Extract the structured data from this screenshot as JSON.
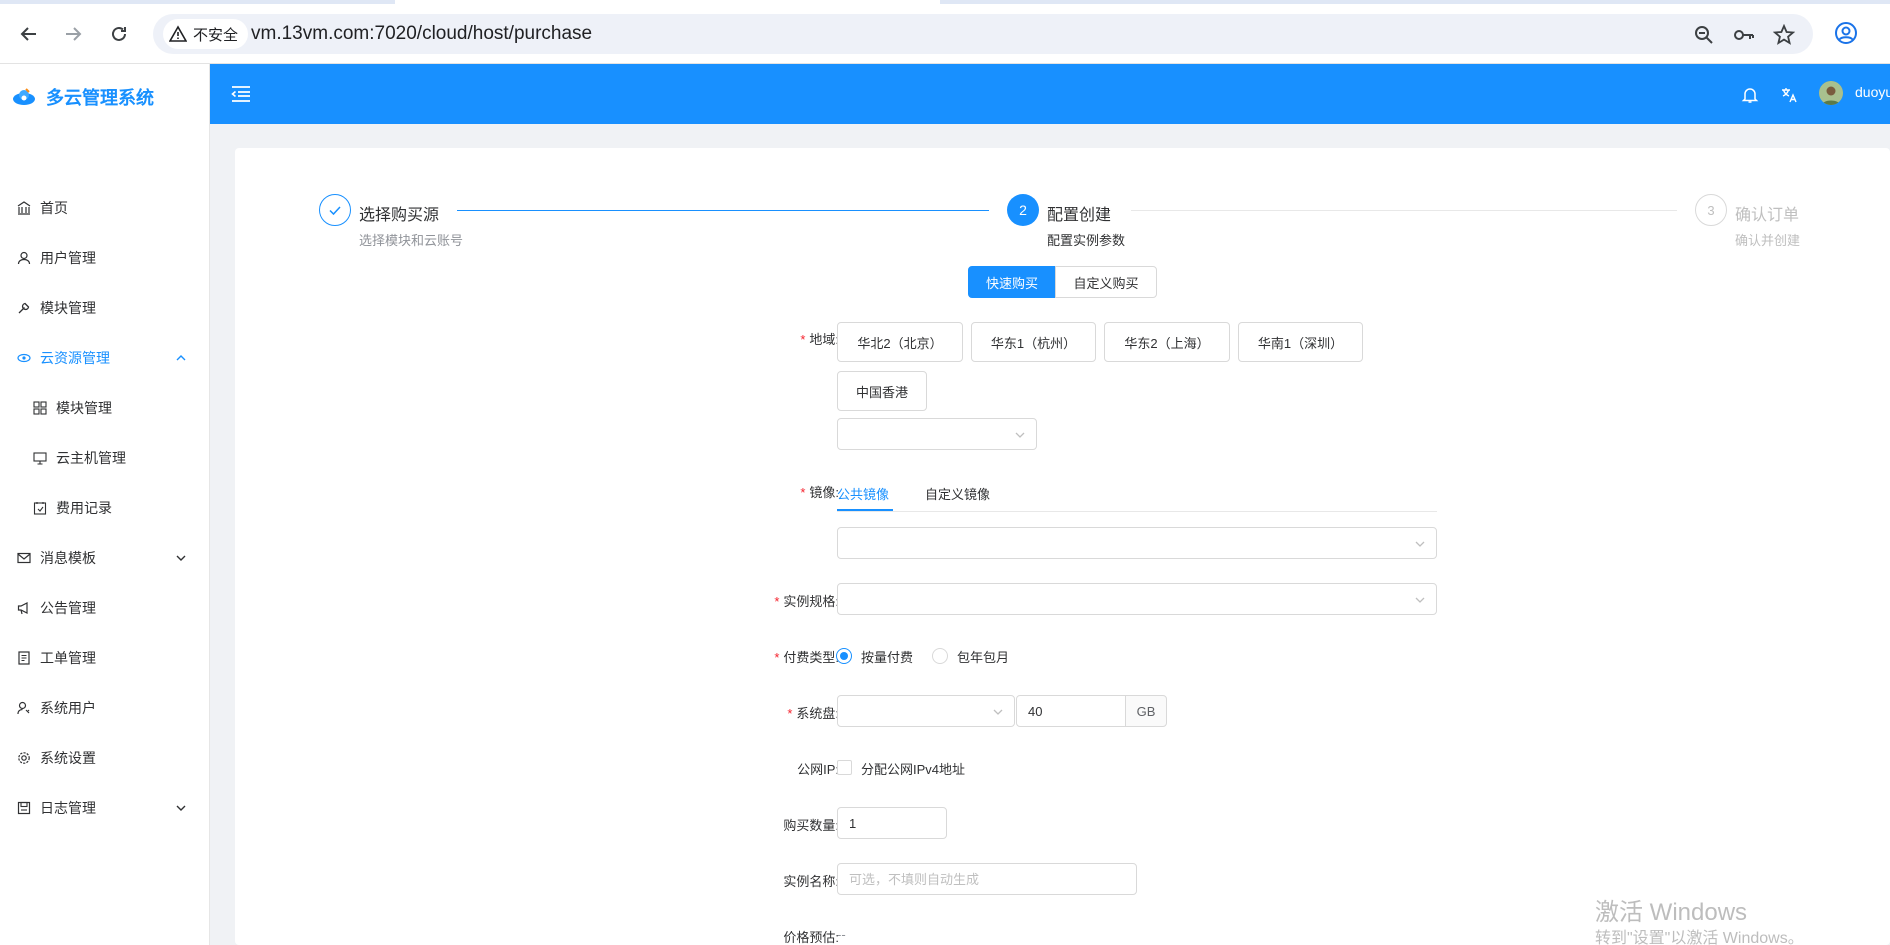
{
  "browser": {
    "insecure_label": "不安全",
    "url": "vm.13vm.com:7020/cloud/host/purchase"
  },
  "app": {
    "name": "多云管理系统",
    "user": "duoyu"
  },
  "sidebar": {
    "items": [
      {
        "label": "首页"
      },
      {
        "label": "用户管理"
      },
      {
        "label": "模块管理"
      },
      {
        "label": "云资源管理"
      },
      {
        "label": "模块管理"
      },
      {
        "label": "云主机管理"
      },
      {
        "label": "费用记录"
      },
      {
        "label": "消息模板"
      },
      {
        "label": "公告管理"
      },
      {
        "label": "工单管理"
      },
      {
        "label": "系统用户"
      },
      {
        "label": "系统设置"
      },
      {
        "label": "日志管理"
      }
    ]
  },
  "steps": [
    {
      "title": "选择购买源",
      "desc": "选择模块和云账号",
      "status": "done"
    },
    {
      "number": "2",
      "title": "配置创建",
      "desc": "配置实例参数",
      "status": "active"
    },
    {
      "number": "3",
      "title": "确认订单",
      "desc": "确认并创建",
      "status": "wait"
    }
  ],
  "mode": {
    "quick": "快速购买",
    "custom": "自定义购买"
  },
  "form": {
    "region": {
      "label": "地域:",
      "options": [
        "华北2（北京）",
        "华东1（杭州）",
        "华东2（上海）",
        "华南1（深圳）",
        "中国香港"
      ]
    },
    "image": {
      "label": "镜像:",
      "tabs": [
        "公共镜像",
        "自定义镜像"
      ]
    },
    "spec": {
      "label": "实例规格:"
    },
    "billing": {
      "label": "付费类型:",
      "options": [
        "按量付费",
        "包年包月"
      ]
    },
    "disk": {
      "label": "系统盘:",
      "size": "40",
      "unit": "GB"
    },
    "public_ip": {
      "label": "公网IP:",
      "option": "分配公网IPv4地址"
    },
    "quantity": {
      "label": "购买数量:",
      "value": "1"
    },
    "name": {
      "label": "实例名称:",
      "placeholder": "可选，不填则自动生成"
    },
    "price": {
      "label": "价格预估:",
      "value": "--"
    }
  },
  "watermark": {
    "line1": "激活 Windows",
    "line2": "转到\"设置\"以激活 Windows。"
  },
  "colors": {
    "primary": "#1890ff",
    "header": "#1890ff",
    "required": "#f5222d"
  }
}
